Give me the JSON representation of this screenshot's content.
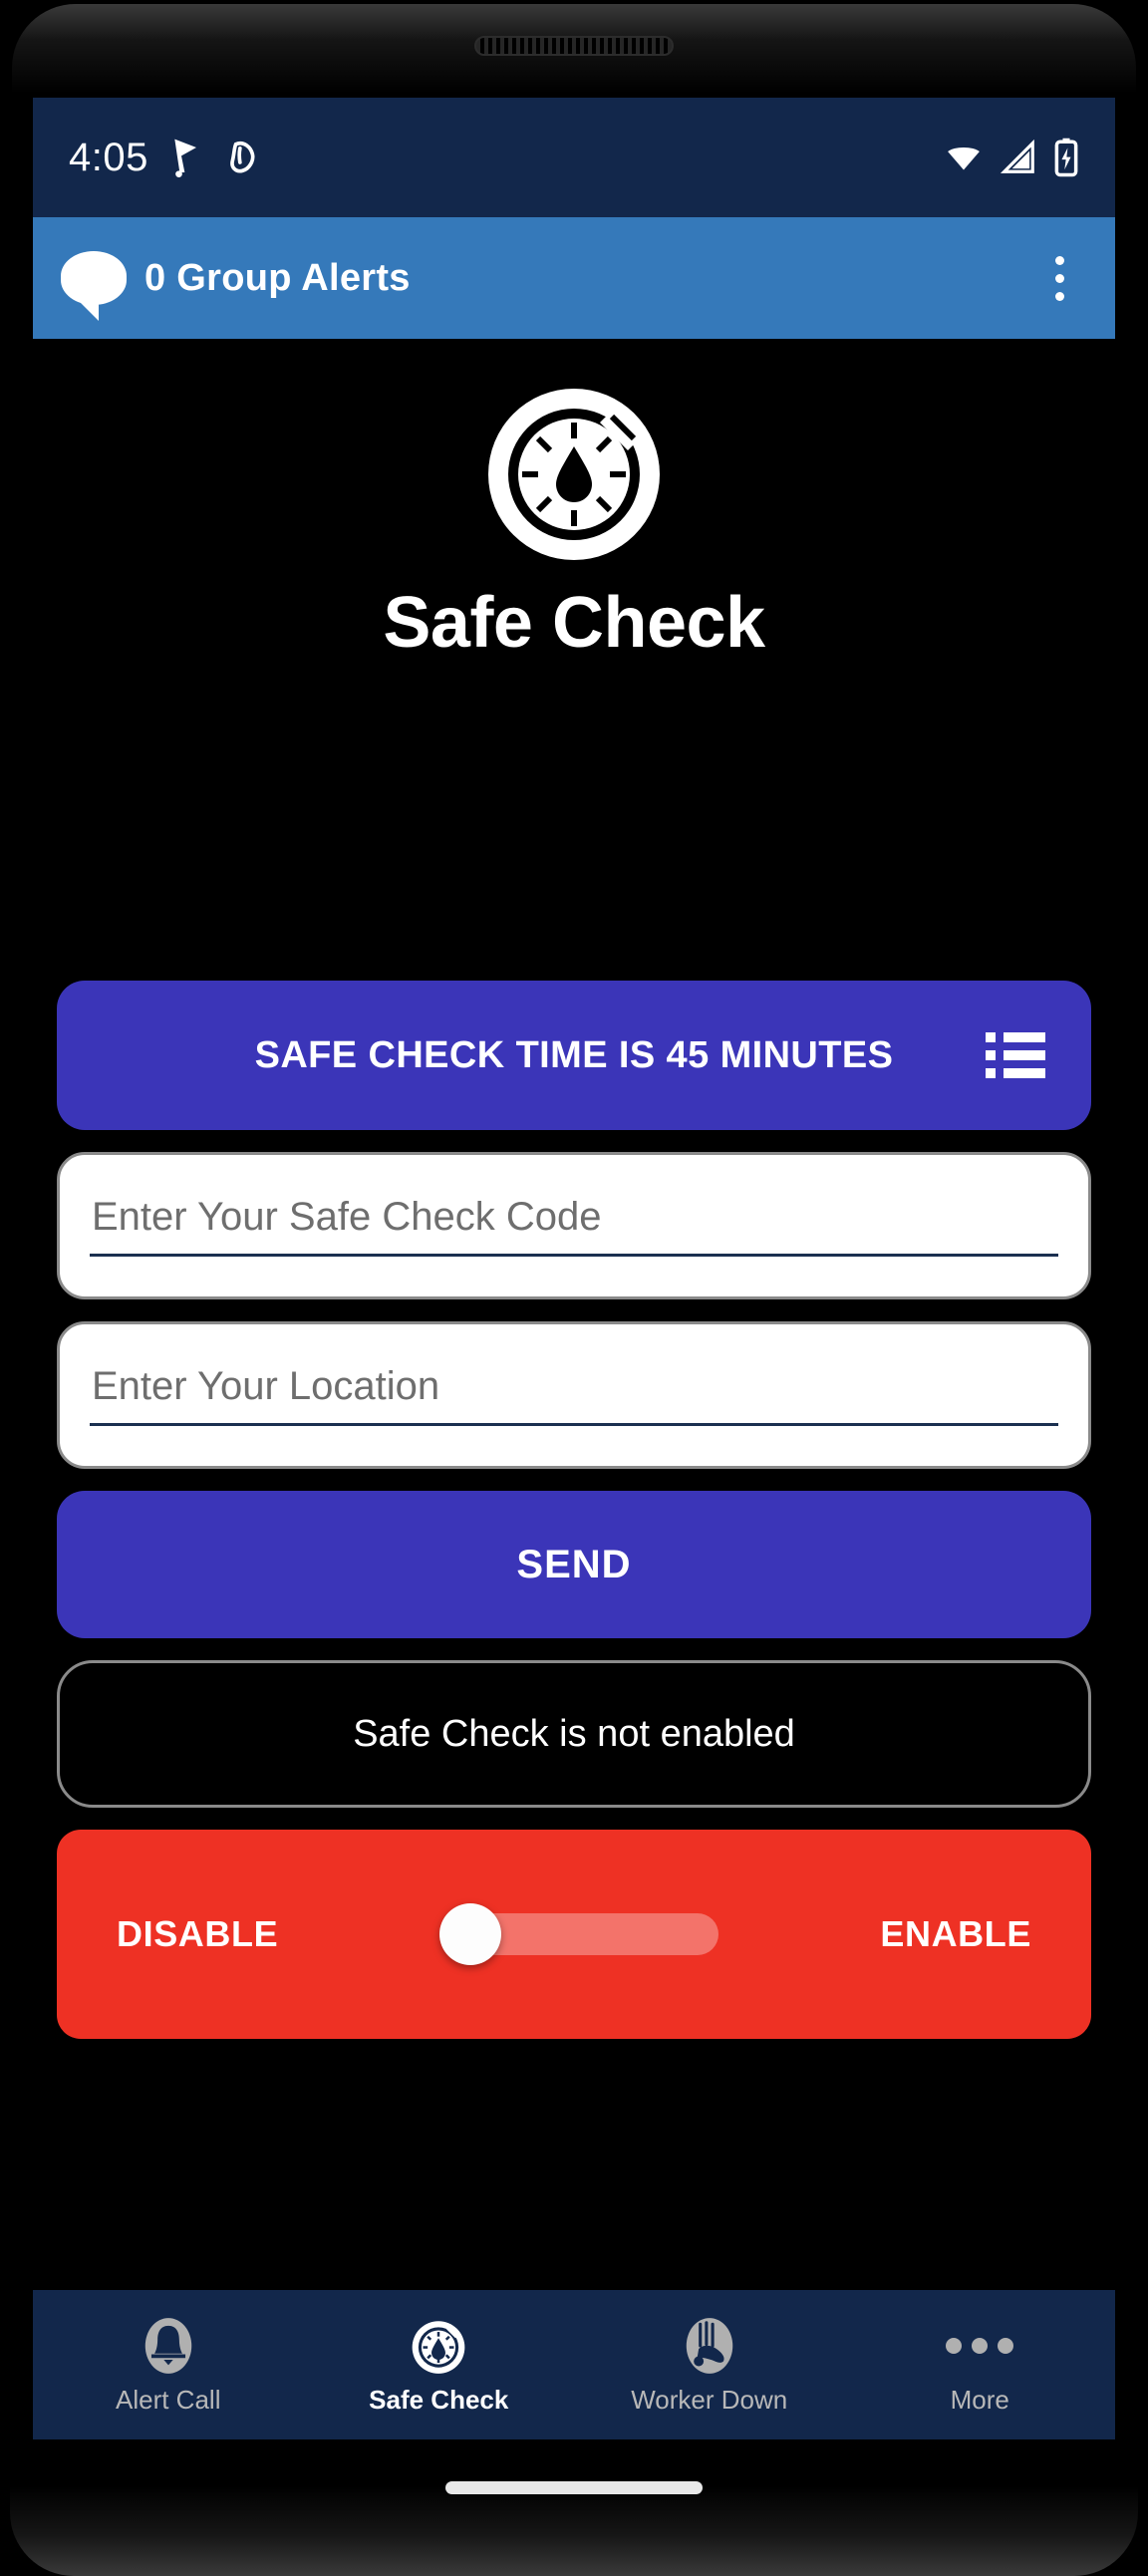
{
  "status_bar": {
    "time": "4:05",
    "left_icons": [
      "location-flag-icon",
      "do-not-disturb-icon"
    ],
    "right_icons": [
      "wifi-icon",
      "cellular-signal-icon",
      "battery-charging-icon"
    ]
  },
  "app_bar": {
    "icon": "speech-bubble-icon",
    "title": "0 Group Alerts",
    "overflow_icon": "overflow-menu-icon"
  },
  "hero": {
    "logo_icon": "safe-check-stopwatch-logo",
    "title": "Safe Check"
  },
  "main": {
    "time_button": {
      "label": "SAFE CHECK TIME IS 45 MINUTES",
      "minutes": 45,
      "trailing_icon": "list-icon"
    },
    "code_field": {
      "placeholder": "Enter Your Safe Check Code",
      "value": ""
    },
    "location_field": {
      "placeholder": "Enter Your Location",
      "value": ""
    },
    "send_button": {
      "label": "SEND"
    },
    "status_box": {
      "text": "Safe Check is not enabled"
    },
    "toggle": {
      "left_label": "DISABLE",
      "right_label": "ENABLE",
      "state": "disabled"
    }
  },
  "bottom_nav": {
    "items": [
      {
        "label": "Alert Call",
        "icon": "bell-icon",
        "active": false
      },
      {
        "label": "Safe Check",
        "icon": "stopwatch-icon",
        "active": true
      },
      {
        "label": "Worker Down",
        "icon": "worker-down-icon",
        "active": false
      },
      {
        "label": "More",
        "icon": "more-dots-icon",
        "active": false
      }
    ]
  },
  "colors": {
    "status_bar_navy": "#12274b",
    "app_bar_blue": "#3579ba",
    "accent_purple": "#3b35b8",
    "alert_red": "#ee3124",
    "screen_black": "#000000"
  }
}
